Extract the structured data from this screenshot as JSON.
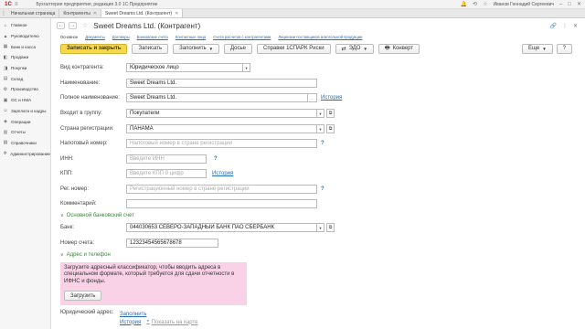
{
  "window": {
    "title": "Бухгалтерия предприятия, редакция 3.0 1С:Предприятие",
    "user": "Иванов Геннадий Сергеевич"
  },
  "tabs": [
    {
      "label": "Начальная страница"
    },
    {
      "label": "Контрагенты"
    },
    {
      "label": "Sweet Dreams Ltd. (Контрагент)"
    }
  ],
  "sidebar": {
    "items": [
      {
        "label": "Главное",
        "icon": "home-icon"
      },
      {
        "label": "Руководителю",
        "icon": "chart-icon"
      },
      {
        "label": "Банк и касса",
        "icon": "bank-icon"
      },
      {
        "label": "Продажи",
        "icon": "sales-icon"
      },
      {
        "label": "Покупки",
        "icon": "cart-icon"
      },
      {
        "label": "Склад",
        "icon": "warehouse-icon"
      },
      {
        "label": "Производство",
        "icon": "factory-icon"
      },
      {
        "label": "ОС и НМА",
        "icon": "assets-icon"
      },
      {
        "label": "Зарплата и кадры",
        "icon": "people-icon"
      },
      {
        "label": "Операции",
        "icon": "operations-icon"
      },
      {
        "label": "Отчеты",
        "icon": "reports-icon"
      },
      {
        "label": "Справочники",
        "icon": "catalog-icon"
      },
      {
        "label": "Администрирование",
        "icon": "gear-icon"
      }
    ]
  },
  "form": {
    "title": "Sweet Dreams Ltd. (Контрагент)",
    "section_tabs": [
      {
        "label": "Основное"
      },
      {
        "label": "Документы"
      },
      {
        "label": "Договоры"
      },
      {
        "label": "Банковские счета"
      },
      {
        "label": "Контактные лица"
      },
      {
        "label": "Счета расчетов с контрагентами"
      },
      {
        "label": "Лицензии поставщиков алкогольной продукции"
      }
    ],
    "toolbar": {
      "save_close": "Записать и закрыть",
      "save": "Записать",
      "fill": "Заполнить",
      "dossier": "Досье",
      "spark": "Справки 1СПАРК Риски",
      "edo": "ЭДО",
      "envelope": "Конверт",
      "more": "Еще",
      "help": "?"
    },
    "fields": {
      "kind_label": "Вид контрагента:",
      "kind_value": "Юридическое лицо",
      "name_label": "Наименование:",
      "name_value": "Sweet Dreams Ltd.",
      "fullname_label": "Полное наименование:",
      "fullname_value": "Sweet Dreams Ltd.",
      "history_link": "История",
      "group_label": "Входит в группу:",
      "group_value": "Покупатели",
      "country_label": "Страна регистрации:",
      "country_value": "ПАНАМА",
      "taxnum_label": "Налоговый номер:",
      "taxnum_placeholder": "Налоговый номер в стране регистрации",
      "inn_label": "ИНН:",
      "inn_placeholder": "Введите ИНН",
      "kpp_label": "КПП:",
      "kpp_placeholder": "Введите КПП 9 цифр",
      "kpp_history": "История",
      "regnum_label": "Рег. номер:",
      "regnum_placeholder": "Регистрационный номер в стране регистрации",
      "comment_label": "Комментарий:",
      "comment_value": ""
    },
    "bank": {
      "group_title": "Основной банковский счет",
      "bank_label": "Банк:",
      "bank_value": "044030653 СЕВЕРО-ЗАПАДНЫЙ БАНК ПАО СБЕРБАНК",
      "account_label": "Номер счета:",
      "account_value": "12323454565678678"
    },
    "address": {
      "group_title": "Адрес и телефон",
      "notice": "Загрузите адресный классификатор, чтобы вводить адреса в специальном формате, который требуется для сдачи отчетности в ИФНС и фонды.",
      "load_button": "Загрузить",
      "legal_label": "Юридический адрес:",
      "fill_link": "Заполнить",
      "history_link": "История",
      "map_link": "Показать на карте"
    }
  }
}
